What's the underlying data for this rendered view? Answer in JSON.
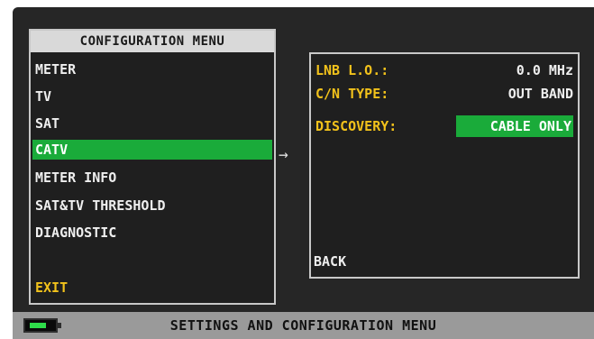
{
  "menu": {
    "title": "CONFIGURATION MENU",
    "items": [
      {
        "label": "METER",
        "selected": false
      },
      {
        "label": "TV",
        "selected": false
      },
      {
        "label": "SAT",
        "selected": false
      },
      {
        "label": "CATV",
        "selected": true
      },
      {
        "label": "METER INFO",
        "selected": false
      },
      {
        "label": "SAT&TV THRESHOLD",
        "selected": false
      },
      {
        "label": "DIAGNOSTIC",
        "selected": false
      }
    ],
    "exit_label": "EXIT"
  },
  "arrow": "→",
  "details": {
    "rows": [
      {
        "label": "LNB L.O.:",
        "value": "0.0 MHz"
      },
      {
        "label": "C/N TYPE:",
        "value": "OUT BAND"
      },
      {
        "label": "DISCOVERY:",
        "value": "CABLE ONLY",
        "selected": true
      }
    ],
    "back_label": "BACK"
  },
  "status_bar": {
    "text": "SETTINGS AND CONFIGURATION MENU",
    "battery_icon": "battery-charging-icon"
  },
  "colors": {
    "selection": "#1aab3a",
    "label_accent": "#f2c21b",
    "panel_border": "#c8c8c8"
  }
}
